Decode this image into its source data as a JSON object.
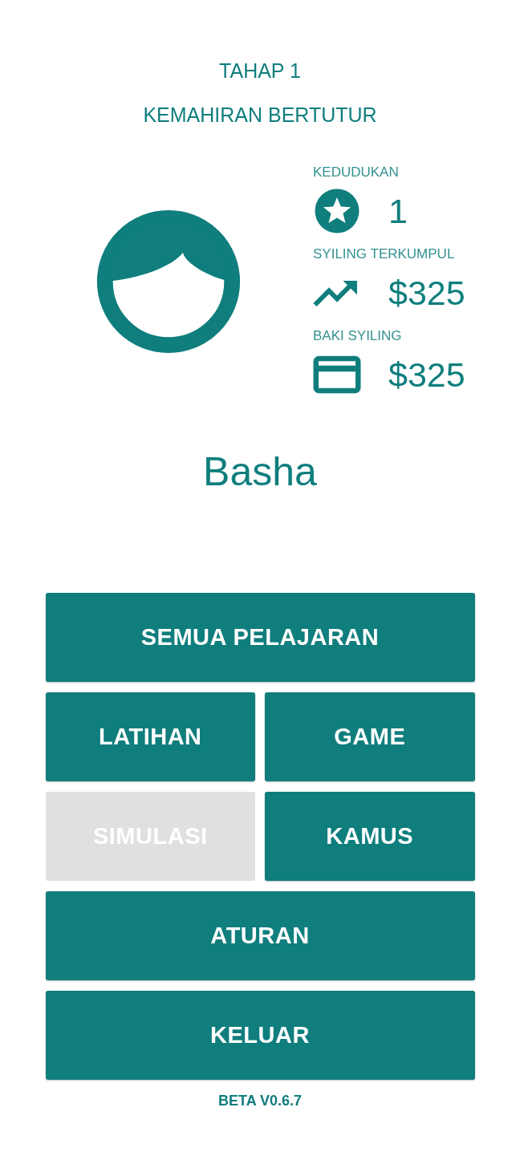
{
  "header": {
    "stage": "TAHAP 1",
    "title": "KEMAHIRAN BERTUTUR"
  },
  "stats": [
    {
      "kind": "rank",
      "label": "KEDUDUKAN",
      "value": "1"
    },
    {
      "kind": "earned",
      "label": "SYILING TERKUMPUL",
      "value": "$325"
    },
    {
      "kind": "balance",
      "label": "BAKI SYILING",
      "value": "$325"
    }
  ],
  "player": {
    "name": "Basha"
  },
  "buttons": [
    {
      "kind": "wide",
      "label": "SEMUA PELAJARAN",
      "disabled": false
    },
    {
      "kind": "half",
      "label": "LATIHAN",
      "disabled": false
    },
    {
      "kind": "half",
      "label": "GAME",
      "disabled": false
    },
    {
      "kind": "half",
      "label": "SIMULASI",
      "disabled": true
    },
    {
      "kind": "half",
      "label": "KAMUS",
      "disabled": false
    },
    {
      "kind": "wide",
      "label": "ATURAN",
      "disabled": false
    },
    {
      "kind": "wide",
      "label": "KELUAR",
      "disabled": false
    }
  ],
  "footer": {
    "version": "BETA V0.6.7"
  }
}
